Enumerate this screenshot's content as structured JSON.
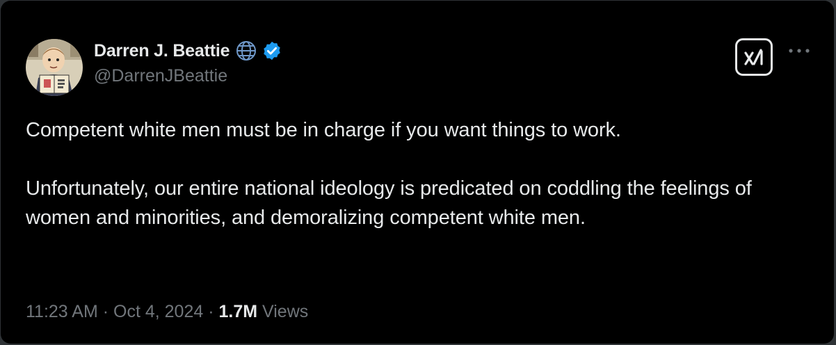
{
  "author": {
    "name": "Darren J. Beattie",
    "handle": "@DarrenJBeattie",
    "avatar_icon": "cartoon-man-reading-book-avatar",
    "affiliation_icon": "globe-icon",
    "verified_icon": "verified-badge-icon",
    "verified_color": "#1d9bf0"
  },
  "actions": {
    "grok_icon": "grok-icon",
    "more_icon": "more-icon"
  },
  "post": {
    "paragraphs": [
      "Competent white men must be in charge if you want things to work.",
      "Unfortunately, our entire national ideology is predicated on coddling the feelings of women and minorities, and demoralizing competent white men."
    ]
  },
  "meta": {
    "time": "11:23 AM",
    "separator": " · ",
    "date": "Oct 4, 2024",
    "views_count": "1.7M",
    "views_label": "Views"
  },
  "colors": {
    "background": "#000000",
    "text_primary": "#e7e9ea",
    "text_secondary": "#71767b"
  }
}
